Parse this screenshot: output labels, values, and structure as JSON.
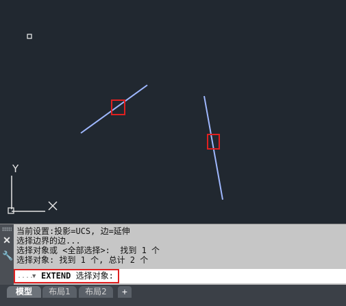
{
  "viewport": {
    "background": "#212830",
    "line_color": "#9fb8ff",
    "grip_color": "#e02020",
    "ucs": {
      "y_label": "Y",
      "x_label": "X"
    }
  },
  "command_line": {
    "history": [
      "当前设置:投影=UCS, 边=延伸",
      "选择边界的边...",
      "选择对象或 <全部选择>:  找到 1 个",
      "选择对象: 找到 1 个, 总计 2 个"
    ],
    "recent_commands_label": "....",
    "command_name": "EXTEND",
    "prompt": "选择对象:",
    "close_icon": "close-icon",
    "settings_icon": "wrench-icon"
  },
  "tabs": [
    {
      "label": "模型",
      "active": true
    },
    {
      "label": "布局1",
      "active": false
    },
    {
      "label": "布局2",
      "active": false
    }
  ],
  "add_tab_label": "+"
}
